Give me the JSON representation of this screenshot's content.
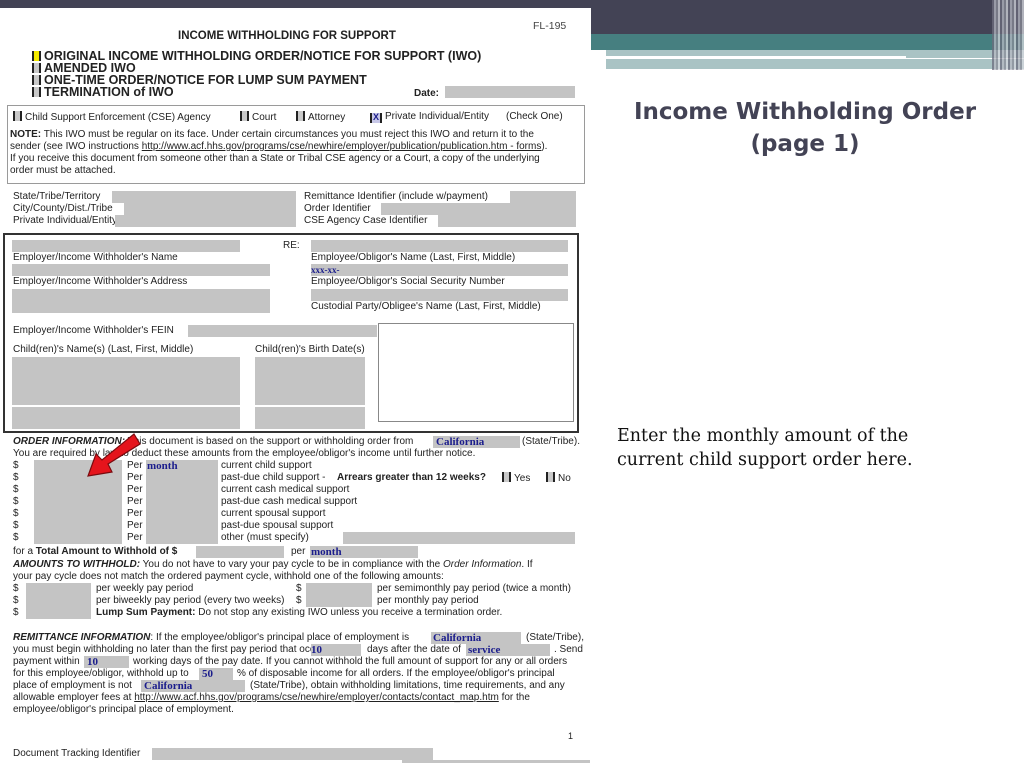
{
  "slide": {
    "title_line1": "Income Withholding Order",
    "title_line2": "(page 1)",
    "caption": "Enter the monthly amount of the current child support order here.",
    "colors": {
      "header_bar": "#434355",
      "teal_band": "#467f80",
      "light_band": "#a9c3c4",
      "arrow": "#e5141c",
      "filled_value": "#1b1d8c"
    }
  },
  "form": {
    "form_number": "FL-195",
    "title": "INCOME WITHHOLDING FOR SUPPORT",
    "order_types": [
      {
        "label": "ORIGINAL INCOME WITHHOLDING ORDER/NOTICE FOR SUPPORT (IWO)",
        "highlighted": true
      },
      {
        "label": "AMENDED IWO",
        "highlighted": false
      },
      {
        "label": "ONE-TIME ORDER/NOTICE FOR LUMP SUM PAYMENT",
        "highlighted": false
      },
      {
        "label": "TERMINATION of IWO",
        "highlighted": false
      }
    ],
    "date_label": "Date:",
    "sender_types": [
      {
        "label": "Child Support Enforcement (CSE) Agency",
        "checked": false
      },
      {
        "label": "Court",
        "checked": false
      },
      {
        "label": "Attorney",
        "checked": false
      },
      {
        "label": "Private Individual/Entity",
        "checked": true
      }
    ],
    "check_one": "(Check One)",
    "checked_mark": "X",
    "note_label": "NOTE:",
    "note_line1": "This IWO must be regular on its face. Under certain circumstances you must reject this IWO and return it to the",
    "note_line2_prefix": "sender (see IWO instructions ",
    "note_link": "http://www.acf.hhs.gov/programs/cse/newhire/employer/publication/publication.htm - forms",
    "note_line2_suffix": ").",
    "note_line3": "If you receive this document from someone other than a State or Tribal CSE agency or a Court, a copy of the underlying",
    "note_line4": "order must be attached.",
    "ids_left": [
      "State/Tribe/Territory",
      "City/County/Dist./Tribe",
      "Private Individual/Entity"
    ],
    "ids_right": [
      "Remittance Identifier (include w/payment)",
      "Order Identifier",
      "CSE Agency Case Identifier"
    ],
    "re_label": "RE:",
    "employer_name_label": "Employer/Income Withholder's Name",
    "employer_address_label": "Employer/Income Withholder's Address",
    "employee_name_label": "Employee/Obligor's Name (Last, First, Middle)",
    "ssn_value": "xxx-xx-",
    "ssn_label": "Employee/Obligor's Social Security Number",
    "custodial_label": "Custodial Party/Obligee's Name (Last, First, Middle)",
    "fein_label": "Employer/Income Withholder's FEIN",
    "children_names_label": "Child(ren)'s Name(s) (Last, First, Middle)",
    "children_dob_label": "Child(ren)'s Birth Date(s)",
    "order_info": {
      "heading": "ORDER INFORMATION:",
      "line1": "This document is based on the support or withholding order from",
      "state_value": "California",
      "state_suffix": "(State/Tribe).",
      "line2": "You are required by law to deduct these amounts from the employee/obligor's income until further notice.",
      "dollar": "$",
      "per": "Per",
      "rows": [
        {
          "per_value": "month",
          "label": "current child support"
        },
        {
          "per_value": "",
          "label": "past-due child support -"
        },
        {
          "per_value": "",
          "label": "current cash medical support"
        },
        {
          "per_value": "",
          "label": "past-due cash medical support"
        },
        {
          "per_value": "",
          "label": "current spousal support"
        },
        {
          "per_value": "",
          "label": "past-due spousal support"
        },
        {
          "per_value": "",
          "label": "other (must specify)"
        }
      ],
      "arrears_question": "Arrears greater than 12 weeks?",
      "yes": "Yes",
      "no": "No",
      "total_prefix": "for a ",
      "total_label": "Total Amount to Withhold",
      "total_of": " of $",
      "total_per": "per",
      "total_per_value": "month"
    },
    "amounts": {
      "heading": "AMOUNTS TO WITHHOLD:",
      "line1": "You do not have to vary your pay cycle to be in compliance with the",
      "line1_italic": "Order Information",
      "line1_end": ". If",
      "line2": "your pay cycle does not match the ordered payment cycle, withhold one of the following amounts:",
      "weekly": "per weekly pay period",
      "semimonthly": "per semimonthly pay period (twice a month)",
      "biweekly": "per biweekly pay period (every two weeks)",
      "monthly": "per monthly pay period",
      "lump_label": "Lump Sum Payment:",
      "lump_text": "Do not stop any existing IWO unless you receive a termination order."
    },
    "remittance": {
      "heading": "REMITTANCE INFORMATION",
      "l1": ": If the employee/obligor's principal place of employment is",
      "state": "California",
      "state_suffix": "(State/Tribe),",
      "l2a": "you must begin withholding no later than the first pay period that occur",
      "days": "10",
      "l2b": "days after the date of",
      "service": "service",
      "l2c": ". Send",
      "l3a": "payment within",
      "pay_days": "10",
      "l3b": "working days of the pay date. If you cannot withhold the full amount of support for any or all orders",
      "l4a": "for this employee/obligor, withhold up to",
      "percent": "50",
      "l4b": "% of disposable income for all orders. If the employee/obligor's principal",
      "l5a": "place of employment is not",
      "state2": "California",
      "l5b": "(State/Tribe), obtain withholding limitations, time requirements, and any",
      "l6a": "allowable employer fees at",
      "link": "http://www.acf.hhs.gov/programs/cse/newhire/employer/contacts/contact_map.htm",
      "l6b": "for the",
      "l7": "employee/obligor's principal place of employment."
    },
    "page_number": "1",
    "tracking_label": "Document Tracking Identifier"
  }
}
